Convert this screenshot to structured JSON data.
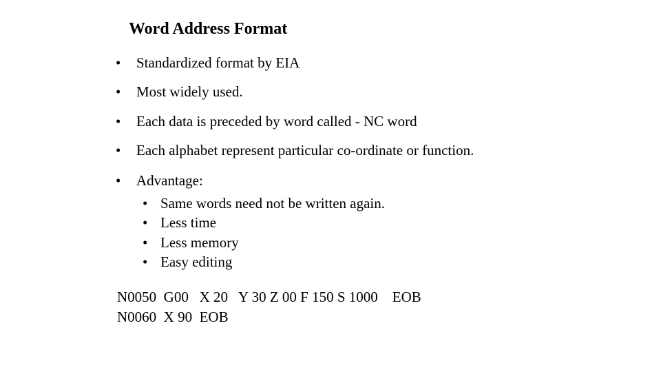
{
  "slide": {
    "title": "Word Address Format",
    "bullet_glyph": "•",
    "bullets": [
      {
        "text": "Standardized format by EIA"
      },
      {
        "text": "Most widely used."
      },
      {
        "text": "Each data is preceded by word called - NC word"
      },
      {
        "text": "Each alphabet represent particular co-ordinate or function."
      },
      {
        "text": "Advantage:"
      }
    ],
    "sub_bullets": [
      {
        "text": "Same words need not be written again."
      },
      {
        "text": "Less time"
      },
      {
        "text": "Less memory"
      },
      {
        "text": "Easy editing"
      }
    ],
    "code_lines": [
      "N0050  G00   X 20   Y 30 Z 00 F 150 S 1000    EOB",
      "N0060  X 90  EOB"
    ]
  }
}
